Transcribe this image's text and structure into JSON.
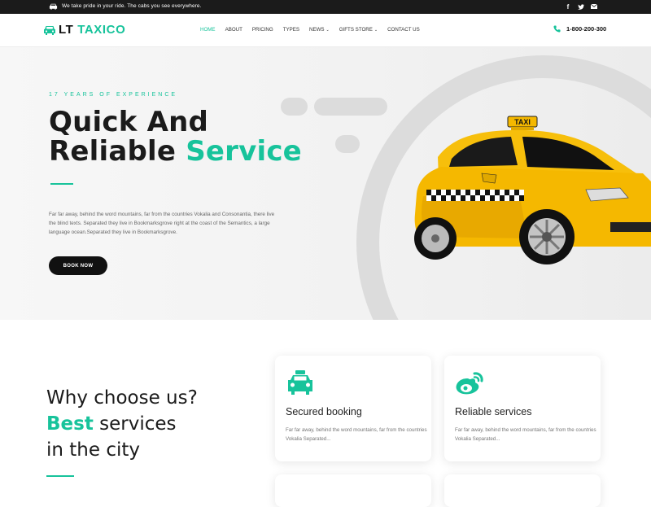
{
  "topbar": {
    "tagline": "We take pride in your ride. The cabs you see everywhere.",
    "social": [
      "f",
      "twitter",
      "mail"
    ]
  },
  "logo": {
    "part1": "LT",
    "part2": "TAXICO"
  },
  "nav": {
    "items": [
      {
        "label": "HOME",
        "active": true,
        "dropdown": false
      },
      {
        "label": "ABOUT",
        "active": false,
        "dropdown": false
      },
      {
        "label": "PRICING",
        "active": false,
        "dropdown": false
      },
      {
        "label": "TYPES",
        "active": false,
        "dropdown": false
      },
      {
        "label": "NEWS",
        "active": false,
        "dropdown": true
      },
      {
        "label": "GIFTS STORE",
        "active": false,
        "dropdown": true
      },
      {
        "label": "CONTACT US",
        "active": false,
        "dropdown": false
      }
    ]
  },
  "phone": "1-800-200-300",
  "hero": {
    "experience": "17 YEARS OF EXPERIENCE",
    "title_line1": "Quick And",
    "title_line2_prefix": "Reliable ",
    "title_line2_accent": "Service",
    "paragraph": "Far far away, behind the word mountains, far from the countries Vokalia and Consonantia, there live the blind texts. Separated they live in Bookmarksgrove right at the coast of the Semantics, a large language ocean.Separated they live in Bookmarksgrove.",
    "book_button": "BOOK NOW",
    "taxi_sign": "TAXI"
  },
  "why": {
    "line1": "Why choose us?",
    "line2_accent": "Best",
    "line2_rest": " services",
    "line3": "in the city"
  },
  "cards": [
    {
      "title": "Secured booking",
      "desc": "Far far away, behind the word mountains, far from the countries Vokalia Separated...",
      "icon": "taxi-icon"
    },
    {
      "title": "Reliable services",
      "desc": "Far far away, behind the word mountains, far from the countries Vokalia Separated...",
      "icon": "weibo-icon"
    }
  ],
  "colors": {
    "accent": "#17c39b",
    "dark": "#1b1b1b",
    "taxi_yellow": "#f5b800"
  }
}
